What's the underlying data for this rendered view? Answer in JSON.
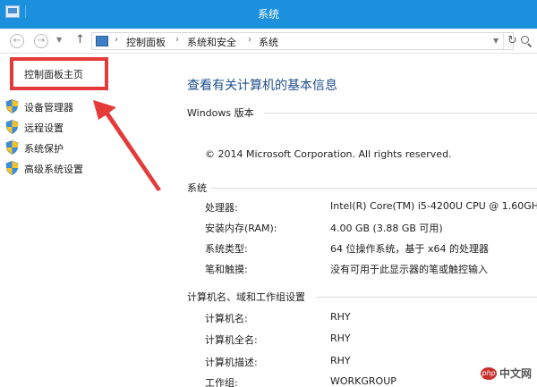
{
  "window": {
    "title": "系统",
    "accent_color": "#1b90dd"
  },
  "address_bar": {
    "crumbs": [
      "控制面板",
      "系统和安全",
      "系统"
    ]
  },
  "left_pane": {
    "home_link": "控制面板主页",
    "tasks": [
      {
        "label": "设备管理器",
        "icon": "shield-icon"
      },
      {
        "label": "远程设置",
        "icon": "shield-icon"
      },
      {
        "label": "系统保护",
        "icon": "shield-icon"
      },
      {
        "label": "高级系统设置",
        "icon": "shield-icon"
      }
    ]
  },
  "main": {
    "page_title": "查看有关计算机的基本信息",
    "windows_edition": {
      "heading": "Windows 版本",
      "copyright": "© 2014 Microsoft Corporation. All rights reserved."
    },
    "system": {
      "heading": "系统",
      "rows": [
        {
          "label": "处理器:",
          "value": "Intel(R) Core(TM) i5-4200U CPU @ 1.60GH"
        },
        {
          "label": "安装内存(RAM):",
          "value": "4.00 GB (3.88 GB 可用)"
        },
        {
          "label": "系统类型:",
          "value": "64 位操作系统，基于 x64 的处理器"
        },
        {
          "label": "笔和触摸:",
          "value": "没有可用于此显示器的笔或触控输入"
        }
      ]
    },
    "computer": {
      "heading": "计算机名、域和工作组设置",
      "rows": [
        {
          "label": "计算机名:",
          "value": "RHY"
        },
        {
          "label": "计算机全名:",
          "value": "RHY"
        },
        {
          "label": "计算机描述:",
          "value": "RHY"
        },
        {
          "label": "工作组:",
          "value": "WORKGROUP"
        }
      ]
    }
  },
  "annotation": {
    "highlight_color": "#e53a3a"
  },
  "watermark": {
    "logo_text": "php",
    "text": "中文网"
  }
}
